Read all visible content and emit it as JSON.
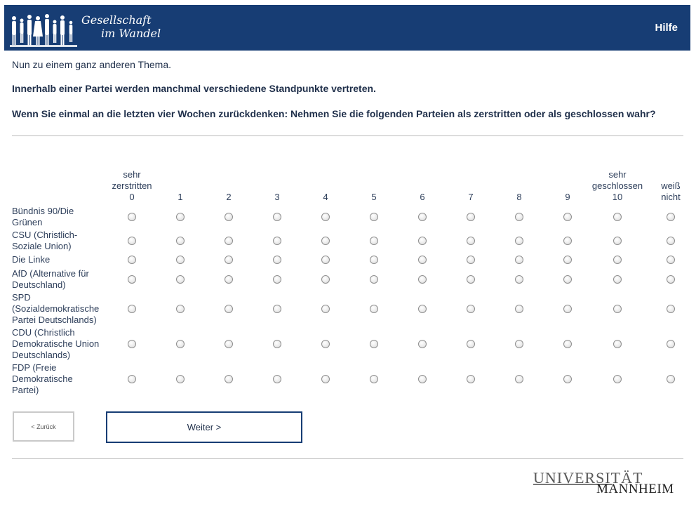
{
  "header": {
    "logo_line1": "Gesellschaft",
    "logo_line2": "im Wandel",
    "help_label": "Hilfe"
  },
  "survey": {
    "intro": "Nun zu einem ganz anderen Thema.",
    "statement": "Innerhalb einer Partei werden manchmal verschiedene Standpunkte vertreten.",
    "question": "Wenn Sie einmal an die letzten vier Wochen zurückdenken: Nehmen Sie die folgenden Parteien als zerstritten oder als geschlossen wahr?"
  },
  "columns": [
    {
      "top": "sehr",
      "mid": "zerstritten",
      "value": "0"
    },
    {
      "top": "",
      "mid": "",
      "value": "1"
    },
    {
      "top": "",
      "mid": "",
      "value": "2"
    },
    {
      "top": "",
      "mid": "",
      "value": "3"
    },
    {
      "top": "",
      "mid": "",
      "value": "4"
    },
    {
      "top": "",
      "mid": "",
      "value": "5"
    },
    {
      "top": "",
      "mid": "",
      "value": "6"
    },
    {
      "top": "",
      "mid": "",
      "value": "7"
    },
    {
      "top": "",
      "mid": "",
      "value": "8"
    },
    {
      "top": "",
      "mid": "",
      "value": "9"
    },
    {
      "top": "sehr",
      "mid": "geschlossen",
      "value": "10"
    },
    {
      "top": "",
      "mid": "weiß",
      "value": "nicht"
    }
  ],
  "rows": [
    {
      "lines": [
        "Bündnis 90/Die",
        "Grünen"
      ]
    },
    {
      "lines": [
        "CSU (Christlich-",
        "Soziale Union)"
      ]
    },
    {
      "lines": [
        "Die Linke"
      ]
    },
    {
      "lines": [
        "AfD (Alternative für",
        "Deutschland)"
      ]
    },
    {
      "lines": [
        "SPD",
        "(Sozialdemokratische",
        "Partei Deutschlands)"
      ]
    },
    {
      "lines": [
        "CDU (Christlich",
        "Demokratische Union",
        "Deutschlands)"
      ]
    },
    {
      "lines": [
        "FDP (Freie",
        "Demokratische",
        "Partei)"
      ]
    }
  ],
  "nav": {
    "back_label": "< Zurück",
    "next_label": "Weiter >"
  },
  "footer": {
    "uni_line1": "UNIVERSITÄT",
    "uni_line2": "MANNHEIM"
  }
}
